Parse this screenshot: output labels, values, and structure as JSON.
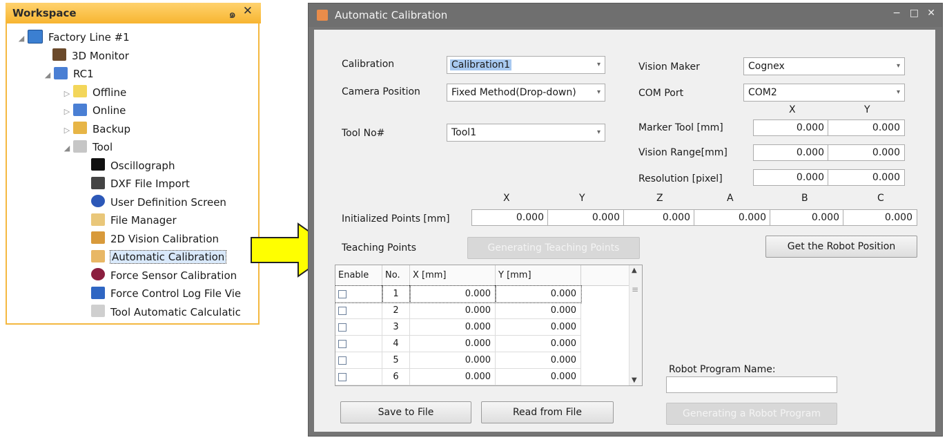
{
  "workspace": {
    "title": "Workspace",
    "pin": "๑",
    "close": "✕",
    "tree": [
      {
        "label": "Factory Line #1",
        "icon": "factory-line-icon",
        "level": 0,
        "expander": "◢"
      },
      {
        "label": "3D Monitor",
        "icon": "3d-monitor-icon",
        "level": 1,
        "expander": ""
      },
      {
        "label": "RC1",
        "icon": "robot-controller-icon",
        "level": 1,
        "expander": "◢"
      },
      {
        "label": "Offline",
        "icon": "offline-icon",
        "level": 2,
        "expander": "▷"
      },
      {
        "label": "Online",
        "icon": "online-icon",
        "level": 2,
        "expander": "▷"
      },
      {
        "label": "Backup",
        "icon": "backup-icon",
        "level": 2,
        "expander": "▷"
      },
      {
        "label": "Tool",
        "icon": "tool-icon",
        "level": 2,
        "expander": "◢"
      },
      {
        "label": "Oscillograph",
        "icon": "oscillograph-icon",
        "level": 3,
        "expander": ""
      },
      {
        "label": "DXF File Import",
        "icon": "dxf-icon",
        "level": 3,
        "expander": ""
      },
      {
        "label": "User Definition Screen",
        "icon": "user-definition-icon",
        "level": 3,
        "expander": ""
      },
      {
        "label": "File Manager",
        "icon": "folder-icon",
        "level": 3,
        "expander": ""
      },
      {
        "label": "2D Vision Calibration",
        "icon": "2d-vision-icon",
        "level": 3,
        "expander": ""
      },
      {
        "label": "Automatic Calibration",
        "icon": "auto-calibration-icon",
        "level": 3,
        "expander": "",
        "selected": true
      },
      {
        "label": "Force Sensor Calibration",
        "icon": "force-sensor-icon",
        "level": 3,
        "expander": ""
      },
      {
        "label": "Force Control Log File Vie",
        "icon": "log-file-icon",
        "level": 3,
        "expander": ""
      },
      {
        "label": "Tool Automatic Calculatic",
        "icon": "pencil-icon",
        "level": 3,
        "expander": ""
      }
    ]
  },
  "dialog": {
    "title": "Automatic Calibration",
    "minimize": "−",
    "maximize": "□",
    "close": "✕",
    "calibration": {
      "label": "Calibration",
      "value": "Calibration1"
    },
    "camera_position": {
      "label": "Camera Position",
      "value": "Fixed Method(Drop-down)"
    },
    "tool_no": {
      "label": "Tool No#",
      "value": "Tool1"
    },
    "vision_maker": {
      "label": "Vision Maker",
      "value": "Cognex"
    },
    "com_port": {
      "label": "COM Port",
      "value": "COM2"
    },
    "xy_headers": [
      "X",
      "Y"
    ],
    "marker_tool": {
      "label": "Marker Tool [mm]",
      "x": "0.000",
      "y": "0.000"
    },
    "vision_range": {
      "label": "Vision Range[mm]",
      "x": "0.000",
      "y": "0.000"
    },
    "resolution": {
      "label": "Resolution [pixel]",
      "x": "0.000",
      "y": "0.000"
    },
    "init_headers": [
      "X",
      "Y",
      "Z",
      "A",
      "B",
      "C"
    ],
    "initialized_points": {
      "label": "Initialized Points [mm]",
      "values": [
        "0.000",
        "0.000",
        "0.000",
        "0.000",
        "0.000",
        "0.000"
      ]
    },
    "teaching_points_label": "Teaching Points",
    "generating_teaching_points": "Generating Teaching Points",
    "get_robot_position": "Get the Robot Position",
    "grid": {
      "headers": [
        "Enable",
        "No.",
        "X [mm]",
        "Y [mm]"
      ],
      "rows": [
        {
          "no": "1",
          "x": "0.000",
          "y": "0.000"
        },
        {
          "no": "2",
          "x": "0.000",
          "y": "0.000"
        },
        {
          "no": "3",
          "x": "0.000",
          "y": "0.000"
        },
        {
          "no": "4",
          "x": "0.000",
          "y": "0.000"
        },
        {
          "no": "5",
          "x": "0.000",
          "y": "0.000"
        },
        {
          "no": "6",
          "x": "0.000",
          "y": "0.000"
        }
      ]
    },
    "robot_program_name_label": "Robot Program Name:",
    "robot_program_name_value": "",
    "save_to_file": "Save to File",
    "read_from_file": "Read from File",
    "generating_robot_program": "Generating a Robot Program",
    "dropdown_arrow": "▾"
  },
  "colors": {
    "workspace_header": "#f7b531",
    "arrow_fill": "#ffff00",
    "titlebar": "#6f6f6f",
    "selection": "#a8c9f0"
  }
}
